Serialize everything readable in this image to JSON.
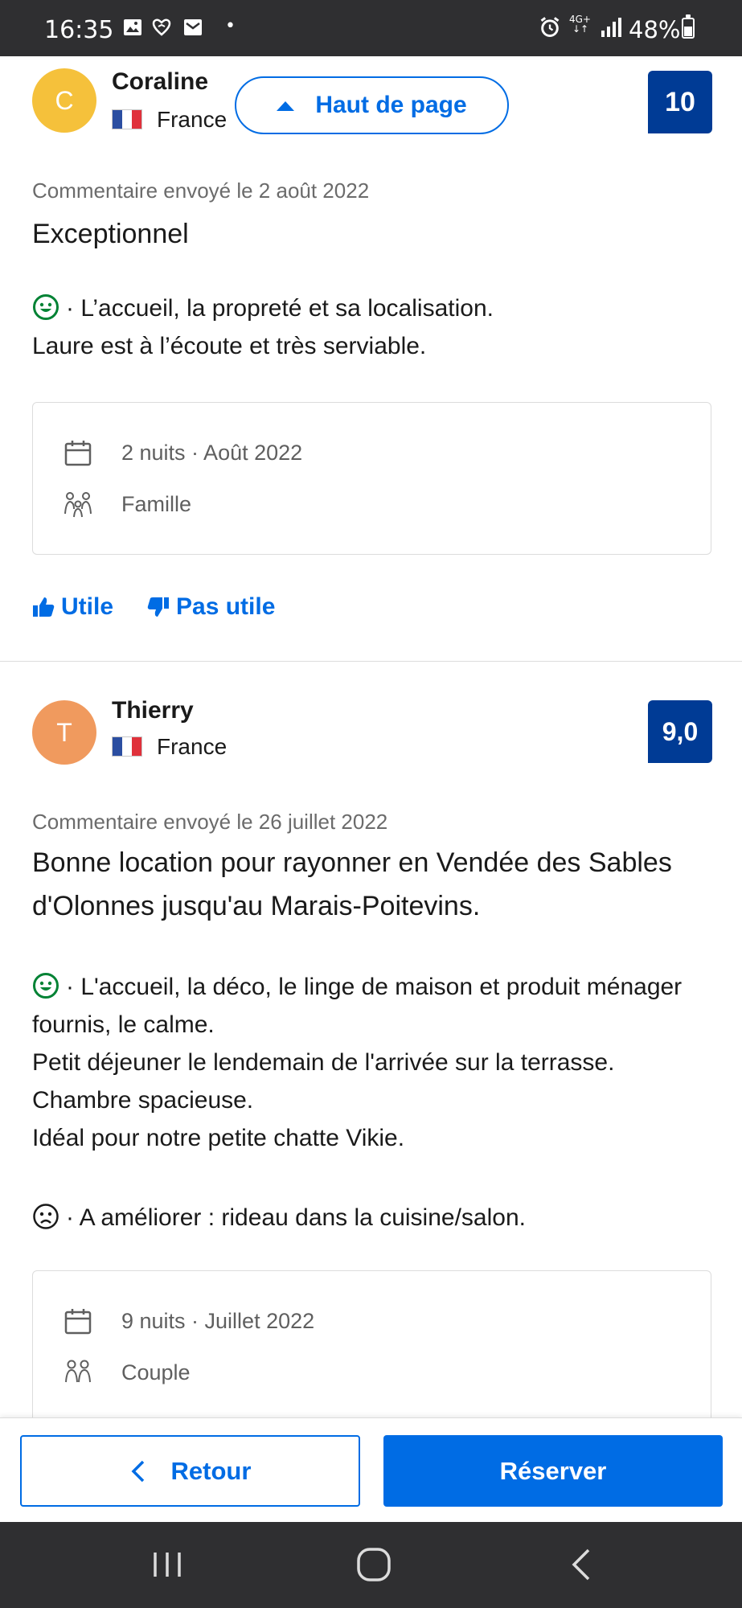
{
  "status_bar": {
    "time": "16:35",
    "dot": "•",
    "network_top": "4G+",
    "network_bottom": "↓↑",
    "battery": "48%",
    "icons": [
      "gallery-icon",
      "heart-shield-icon",
      "mail-icon",
      "alarm-icon",
      "signal-icon",
      "battery-icon"
    ]
  },
  "back_to_top": {
    "label": "Haut de page"
  },
  "reviews": [
    {
      "avatar_letter": "C",
      "avatar_color": "#f5c13b",
      "name": "Coraline",
      "country": "France",
      "score": "10",
      "date": "Commentaire envoyé le 2 août 2022",
      "title": "Exceptionnel",
      "positive": "· L’accueil, la propreté et sa localisation.",
      "positive_more": "Laure est à l’écoute et très serviable.",
      "stay": "2 nuits · Août 2022",
      "traveler_type": "Famille"
    },
    {
      "avatar_letter": "T",
      "avatar_color": "#f09a5e",
      "name": "Thierry",
      "country": "France",
      "score": "9,0",
      "date": "Commentaire envoyé le 26 juillet 2022",
      "title": "Bonne location pour rayonner en Vendée des Sables d'Olonnes jusqu'au Marais-Poitevins.",
      "positive": "· L'accueil, la déco, le linge de maison et produit ménager fournis, le calme.",
      "positive_more": [
        "Petit déjeuner le lendemain de l'arrivée sur la terrasse.",
        "Chambre spacieuse.",
        "Idéal pour notre petite chatte Vikie."
      ],
      "negative": "· A améliorer : rideau dans la cuisine/salon.",
      "stay": "9 nuits · Juillet 2022",
      "traveler_type": "Couple"
    }
  ],
  "feedback": {
    "helpful": "Utile",
    "not_helpful": "Pas utile"
  },
  "bottom_bar": {
    "back": "Retour",
    "book": "Réserver"
  },
  "colors": {
    "brand_blue": "#006ce4",
    "score_blue": "#003b95",
    "positive_green": "#008234",
    "system_bar": "#2f2f31"
  }
}
